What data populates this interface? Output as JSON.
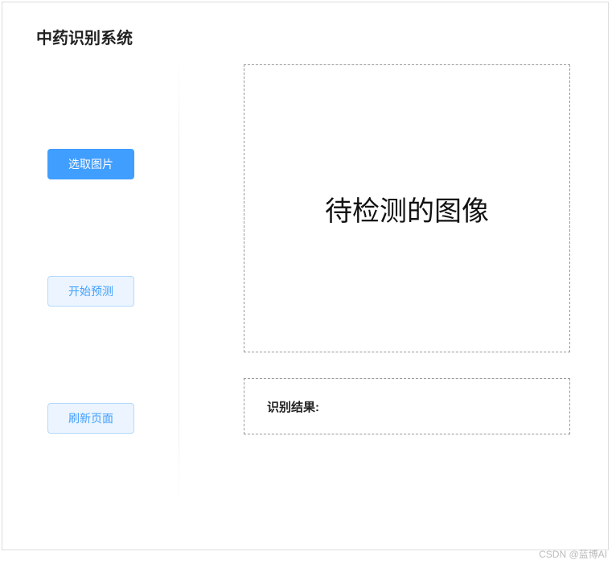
{
  "title": "中药识别系统",
  "sidebar": {
    "select_image_label": "选取图片",
    "start_predict_label": "开始预测",
    "refresh_page_label": "刷新页面"
  },
  "main": {
    "image_placeholder": "待检测的图像",
    "result_label": "识别结果:"
  },
  "watermark": "CSDN @蓝博AI"
}
